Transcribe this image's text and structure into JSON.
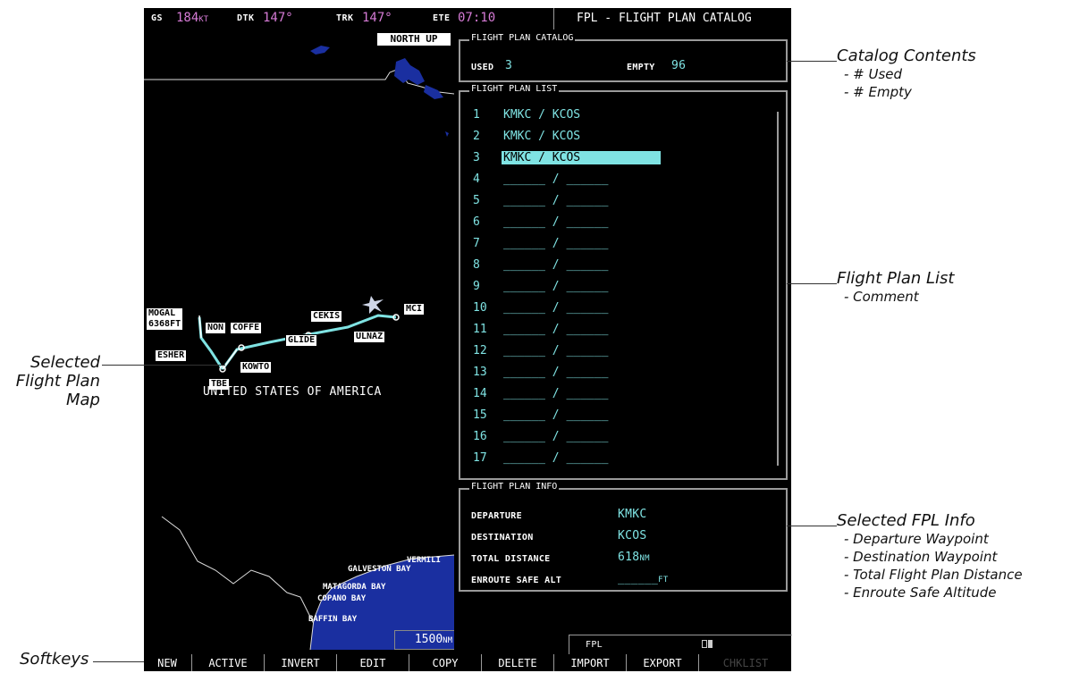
{
  "top_bar": {
    "gs_label": "GS",
    "gs_value": "184",
    "gs_unit": "KT",
    "dtk_label": "DTK",
    "dtk_value": "147°",
    "trk_label": "TRK",
    "trk_value": "147°",
    "ete_label": "ETE",
    "ete_value": "07:10",
    "page_title": "FPL - FLIGHT PLAN CATALOG"
  },
  "map": {
    "orientation": "NORTH UP",
    "range_value": "1500",
    "range_unit": "NM",
    "country_label": "UNITED STATES OF AMERICA",
    "waypoints": [
      "MOGAL",
      "6368FT",
      "NON",
      "COFFE",
      "CEKIS",
      "MCI",
      "ESHER",
      "TBE",
      "GLIDE",
      "ULNAZ",
      "KOWTO"
    ],
    "water_labels": [
      "VERMILI",
      "GALVESTON BAY",
      "MATAGORDA BAY",
      "COPANO BAY",
      "BAFFIN BAY"
    ]
  },
  "catalog": {
    "title": "FLIGHT PLAN CATALOG",
    "used_label": "USED",
    "used_value": "3",
    "empty_label": "EMPTY",
    "empty_value": "96"
  },
  "list": {
    "title": "FLIGHT PLAN LIST",
    "rows": [
      {
        "num": "1",
        "name": "KMKC / KCOS"
      },
      {
        "num": "2",
        "name": "KMKC / KCOS"
      },
      {
        "num": "3",
        "name": "KMKC / KCOS"
      },
      {
        "num": "4",
        "name": "______ / ______"
      },
      {
        "num": "5",
        "name": "______ / ______"
      },
      {
        "num": "6",
        "name": "______ / ______"
      },
      {
        "num": "7",
        "name": "______ / ______"
      },
      {
        "num": "8",
        "name": "______ / ______"
      },
      {
        "num": "9",
        "name": "______ / ______"
      },
      {
        "num": "10",
        "name": "______ / ______"
      },
      {
        "num": "11",
        "name": "______ / ______"
      },
      {
        "num": "12",
        "name": "______ / ______"
      },
      {
        "num": "13",
        "name": "______ / ______"
      },
      {
        "num": "14",
        "name": "______ / ______"
      },
      {
        "num": "15",
        "name": "______ / ______"
      },
      {
        "num": "16",
        "name": "______ / ______"
      },
      {
        "num": "17",
        "name": "______ / ______"
      }
    ],
    "selected_index": 3
  },
  "info": {
    "title": "FLIGHT PLAN INFO",
    "departure_label": "DEPARTURE",
    "departure_value": "KMKC",
    "destination_label": "DESTINATION",
    "destination_value": "KCOS",
    "distance_label": "TOTAL DISTANCE",
    "distance_value": "618",
    "distance_unit": "NM",
    "esa_label": "ENROUTE SAFE ALT",
    "esa_value": "______",
    "esa_unit": "FT"
  },
  "status": {
    "fpl_label": "FPL"
  },
  "softkeys": [
    "NEW",
    "ACTIVE",
    "INVERT",
    "EDIT",
    "COPY",
    "DELETE",
    "IMPORT",
    "EXPORT",
    "CHKLIST"
  ],
  "callouts": {
    "catalog": {
      "title": "Catalog Contents",
      "lines": [
        "- # Used",
        "- # Empty"
      ]
    },
    "list": {
      "title": "Flight Plan List",
      "lines": [
        "- Comment"
      ]
    },
    "map": {
      "lines": [
        "Selected",
        "Flight Plan",
        "Map"
      ]
    },
    "info": {
      "title": "Selected FPL Info",
      "lines": [
        "- Departure Waypoint",
        "- Destination Waypoint",
        "- Total Flight Plan Distance",
        "- Enroute Safe Altitude"
      ]
    },
    "softkeys": {
      "title": "Softkeys"
    }
  },
  "colors": {
    "accent_cyan": "#7fe3e3",
    "magenta": "#d67bd6",
    "water": "#1a2fa0"
  }
}
